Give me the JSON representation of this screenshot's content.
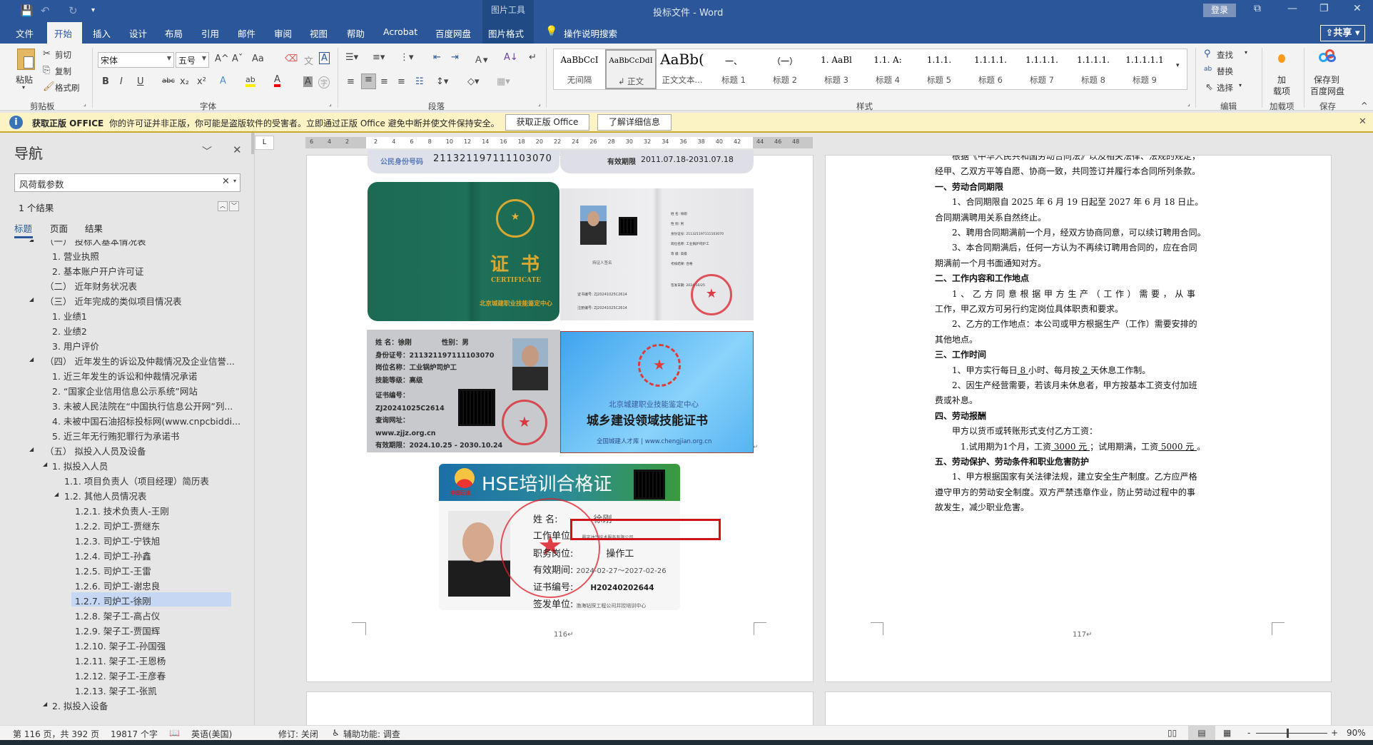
{
  "titlebar": {
    "doc_title": "投标文件 - Word",
    "context_group": "图片工具",
    "login": "登录",
    "share": "共享",
    "qat": {
      "save": "💾",
      "undo": "↶",
      "redo": "↻",
      "customize": "▾"
    },
    "window": {
      "ribbon_opts": "⧉",
      "minimize": "—",
      "restore": "❐",
      "close": "✕"
    }
  },
  "tabs": [
    {
      "label": "文件"
    },
    {
      "label": "开始"
    },
    {
      "label": "插入"
    },
    {
      "label": "设计"
    },
    {
      "label": "布局"
    },
    {
      "label": "引用"
    },
    {
      "label": "邮件"
    },
    {
      "label": "审阅"
    },
    {
      "label": "视图"
    },
    {
      "label": "帮助"
    },
    {
      "label": "Acrobat"
    },
    {
      "label": "百度网盘"
    },
    {
      "label": "图片格式"
    }
  ],
  "tell_me": "操作说明搜索",
  "ribbon": {
    "clipboard": {
      "paste": "粘贴",
      "cut": "剪切",
      "copy": "复制",
      "format_painter": "格式刷",
      "group": "剪贴板"
    },
    "font": {
      "name": "宋体",
      "size": "五号",
      "group": "字体",
      "bold": "B",
      "italic": "I",
      "underline": "U",
      "strike": "abc",
      "sub": "x₂",
      "sup": "x²",
      "grow": "A^",
      "shrink": "Aˇ",
      "case": "Aa",
      "clear": "⌫",
      "phonetic": "文",
      "border": "A",
      "effects": "A",
      "highlight": "ab",
      "color": "A",
      "shading": "A",
      "enclose": "字"
    },
    "paragraph": {
      "group": "段落"
    },
    "styles": {
      "group": "样式",
      "items": [
        {
          "preview": "AaBbCcI",
          "label": "无间隔"
        },
        {
          "preview": "AaBbCcDdI",
          "label": "↲ 正文"
        },
        {
          "preview": "AaBb(",
          "label": "正文文本..."
        },
        {
          "preview": "一、",
          "label": "标题 1"
        },
        {
          "preview": "（一）",
          "label": "标题 2"
        },
        {
          "preview": "1.  AaBl",
          "label": "标题 3"
        },
        {
          "preview": "1.1.  A:",
          "label": "标题 4"
        },
        {
          "preview": "1.1.1.",
          "label": "标题 5"
        },
        {
          "preview": "1.1.1.1.",
          "label": "标题 6"
        },
        {
          "preview": "1.1.1.1.",
          "label": "标题 7"
        },
        {
          "preview": "1.1.1.1.",
          "label": "标题 8"
        },
        {
          "preview": "1.1.1.1.1",
          "label": "标题 9"
        }
      ]
    },
    "editing": {
      "find": "查找",
      "replace": "替换",
      "select": "选择",
      "group": "编辑"
    },
    "addins": {
      "line1": "加",
      "line2": "载项",
      "group": "加载项"
    },
    "save": {
      "line1": "保存到",
      "line2": "百度网盘",
      "group": "保存"
    }
  },
  "notice": {
    "title": "获取正版 OFFICE",
    "message": "你的许可证并非正版，你可能是盗版软件的受害者。立即通过正版 Office 避免中断并使文件保持安全。",
    "btn_get": "获取正版 Office",
    "btn_learn": "了解详细信息",
    "close": "✕"
  },
  "nav": {
    "title": "导航",
    "search_value": "风荷载参数",
    "result_count": "1 个结果",
    "tabs": [
      "标题",
      "页面",
      "结果"
    ],
    "items": [
      {
        "label": "（一）  投标人基本情况表",
        "level": 1,
        "arrow": true
      },
      {
        "label": "1. 营业执照",
        "level": 2
      },
      {
        "label": "2. 基本账户开户许可证",
        "level": 2
      },
      {
        "label": "（二）  近年财务状况表",
        "level": 1
      },
      {
        "label": "（三）  近年完成的类似项目情况表",
        "level": 1,
        "arrow": true
      },
      {
        "label": "1. 业绩1",
        "level": 2
      },
      {
        "label": "2. 业绩2",
        "level": 2
      },
      {
        "label": "3. 用户评价",
        "level": 2
      },
      {
        "label": "（四）  近年发生的诉讼及仲裁情况及企业信誉...",
        "level": 1,
        "arrow": true
      },
      {
        "label": "1. 近三年发生的诉讼和仲裁情况承诺",
        "level": 2
      },
      {
        "label": "2. “国家企业信用信息公示系统”网站",
        "level": 2
      },
      {
        "label": "3. 未被人民法院在“中国执行信息公开网”列...",
        "level": 2
      },
      {
        "label": "4. 未被中国石油招标投标网(www.cnpcbiddi...",
        "level": 2
      },
      {
        "label": "5. 近三年无行贿犯罪行为承诺书",
        "level": 2
      },
      {
        "label": "（五）  拟投入人员及设备",
        "level": 1,
        "arrow": true
      },
      {
        "label": "1. 拟投入人员",
        "level": 2,
        "arrow": true
      },
      {
        "label": "1.1. 项目负责人（项目经理）简历表",
        "level": 3
      },
      {
        "label": "1.2. 其他人员情况表",
        "level": 3,
        "arrow": true
      },
      {
        "label": "1.2.1. 技术负责人-王刚",
        "level": 4
      },
      {
        "label": "1.2.2. 司炉工-贾继东",
        "level": 4
      },
      {
        "label": "1.2.3. 司炉工-宁铁旭",
        "level": 4
      },
      {
        "label": "1.2.4. 司炉工-孙鑫",
        "level": 4
      },
      {
        "label": "1.2.5. 司炉工-王雷",
        "level": 4
      },
      {
        "label": "1.2.6. 司炉工-谢忠良",
        "level": 4
      },
      {
        "label": "1.2.7. 司炉工-徐刚",
        "level": 4,
        "selected": true
      },
      {
        "label": "1.2.8. 架子工-高占仪",
        "level": 4
      },
      {
        "label": "1.2.9. 架子工-贾国辉",
        "level": 4
      },
      {
        "label": "1.2.10. 架子工-孙国强",
        "level": 4
      },
      {
        "label": "1.2.11. 架子工-王恩杨",
        "level": 4
      },
      {
        "label": "1.2.12. 架子工-王彦春",
        "level": 4
      },
      {
        "label": "1.2.13. 架子工-张凯",
        "level": 4
      },
      {
        "label": "2. 拟投入设备",
        "level": 2,
        "arrow": true
      }
    ]
  },
  "ruler": {
    "left": [
      "6",
      "4",
      "2"
    ],
    "main": [
      "2",
      "4",
      "6",
      "8",
      "10",
      "12",
      "14",
      "16",
      "18",
      "20",
      "22",
      "24",
      "26",
      "28",
      "30",
      "32",
      "34",
      "36",
      "38",
      "40",
      "42"
    ],
    "right": [
      "44",
      "46",
      "48"
    ],
    "tab_selector": "L"
  },
  "page1": {
    "page_number": "116↵",
    "id_strip": {
      "left_label": "公民身份号码",
      "left_value": "211321197111103070",
      "right_label": "有效期限",
      "right_value": "2011.07.18-2031.07.18"
    },
    "green_cert": {
      "title": "证  书",
      "subtitle": "CERTIFICATE",
      "issuer": "北京城建职业技能鉴定中心"
    },
    "open_book": {
      "name": "姓    名: 徐刚",
      "gender": "性    别: 男",
      "id": "身份证号: 211321197111103070",
      "post": "岗位名称: 工业锅炉司炉工",
      "grade": "等    级: 高级",
      "result": "考核结果: 合格",
      "cert_no": "证书编号: ZJ20241025C2614",
      "reg_no": "注册编号: ZJ20241025C2614",
      "sign": "持证人签名",
      "issue_date": "签发日期: 2024/10/25"
    },
    "id_card": {
      "name": "姓    名：徐刚",
      "gender": "性别：男",
      "id": "身份证号：211321197111103070",
      "post": "岗位名称：工业锅炉司炉工",
      "grade": "技能等级：高级",
      "cert_label": "证书编号：",
      "cert_no": "ZJ20241025C2614",
      "url_label": "查询网址：",
      "url": "www.zjjz.org.cn",
      "valid": "有效期限：2024.10.25 - 2030.10.24"
    },
    "blue_card": {
      "issuer": "北京城建职业技能鉴定中心",
      "title": "城乡建设领域技能证书",
      "footer": "全国城建人才库 | www.chengjian.org.cn"
    },
    "hse_card": {
      "title": "HSE培训合格证",
      "logo_text": "中国石油",
      "name_label": "姓    名:",
      "name": "徐刚",
      "unit_label": "工作单位:",
      "unit": "…晨宇油气技术服务有限公司",
      "post_label": "职务岗位:",
      "post": "操作工",
      "valid_label": "有效期间:",
      "valid": "2024-02-27～2027-02-26",
      "no_label": "证书编号:",
      "no": "H20240202644",
      "issuer_label": "签发单位:",
      "issuer": "渤海钻探工程公司井控培训中心"
    },
    "annotation_color": "#d0121b"
  },
  "page2": {
    "page_number": "117↵",
    "lines": [
      {
        "cls": "i",
        "seg": [
          {
            "t": "根据《中华人民共和国劳动合同法》以及相关法律、法规的规定，"
          }
        ]
      },
      {
        "cls": "",
        "seg": [
          {
            "t": "经甲、乙双方平等自愿、协商一致，共同签订并履行本合同所列条款。"
          }
        ]
      },
      {
        "cls": "h",
        "seg": [
          {
            "t": "一、劳动合同期限"
          }
        ]
      },
      {
        "cls": "i j",
        "seg": [
          {
            "t": "1、合同期限自 2025 年 6 月 19 日起至 2027 年 6 月 18 日止。"
          }
        ]
      },
      {
        "cls": "",
        "seg": [
          {
            "t": "合同期满聘用关系自然终止。"
          }
        ]
      },
      {
        "cls": "i",
        "seg": [
          {
            "t": "2、聘用合同期满前一个月，经双方协商同意，可以续订聘用合同。"
          }
        ]
      },
      {
        "cls": "i j",
        "seg": [
          {
            "t": "3、本合同期满后，任何一方认为不再续订聘用合同的，应在合同"
          }
        ]
      },
      {
        "cls": "",
        "seg": [
          {
            "t": "期满前一个月书面通知对方。"
          }
        ]
      },
      {
        "cls": "h",
        "seg": [
          {
            "t": "二、工作内容和工作地点"
          }
        ]
      },
      {
        "cls": "i j",
        "seg": [
          {
            "t": "1、乙方同意根据甲方生产（工作）需要，从事"
          }
        ]
      },
      {
        "cls": "",
        "seg": [
          {
            "t": "工作，甲乙双方可另行约定岗位具体职责和要求。"
          }
        ]
      },
      {
        "cls": "i j",
        "seg": [
          {
            "t": "2、乙方的工作地点：本公司或甲方根据生产（工作）需要安排的"
          }
        ]
      },
      {
        "cls": "",
        "seg": [
          {
            "t": "其他地点。"
          }
        ]
      },
      {
        "cls": "h",
        "seg": [
          {
            "t": "三、工作时间"
          }
        ]
      },
      {
        "cls": "i",
        "seg": [
          {
            "t": "1、甲方实行每日"
          },
          {
            "t": " 8 ",
            "u": true
          },
          {
            "t": "小时、每月按"
          },
          {
            "t": " 2 ",
            "u": true
          },
          {
            "t": "天休息工作制。"
          }
        ]
      },
      {
        "cls": "i j",
        "seg": [
          {
            "t": "2、因生产经营需要，若该月未休息者，甲方按基本工资支付加班"
          }
        ]
      },
      {
        "cls": "",
        "seg": [
          {
            "t": "费或补息。"
          }
        ]
      },
      {
        "cls": "h",
        "seg": [
          {
            "t": "四、劳动报酬"
          }
        ]
      },
      {
        "cls": "i",
        "seg": [
          {
            "t": "甲方以货币或转账形式支付乙方工资："
          }
        ]
      },
      {
        "cls": "i2",
        "seg": [
          {
            "t": "1.试用期为1个月，工资"
          },
          {
            "t": " 3000 元 ",
            "u": true
          },
          {
            "t": "；试用期满，工资"
          },
          {
            "t": " 5000 元 ",
            "u": true
          },
          {
            "t": "。"
          }
        ]
      },
      {
        "cls": "h",
        "seg": [
          {
            "t": "五、劳动保护、劳动条件和职业危害防护"
          }
        ]
      },
      {
        "cls": "i j",
        "seg": [
          {
            "t": "1、甲方根据国家有关法律法规，建立安全生产制度。乙方应严格"
          }
        ]
      },
      {
        "cls": "j",
        "seg": [
          {
            "t": "遵守甲方的劳动安全制度。双方严禁违章作业，防止劳动过程中的事"
          }
        ]
      },
      {
        "cls": "",
        "seg": [
          {
            "t": "故发生，减少职业危害。"
          }
        ]
      }
    ]
  },
  "status": {
    "page": "第 116 页，共 392 页",
    "words": "19817 个字",
    "language": "英语(美国)",
    "track": "修订: 关闭",
    "accessibility": "辅助功能: 调查",
    "zoom": "90%",
    "zoom_percent": 90
  }
}
